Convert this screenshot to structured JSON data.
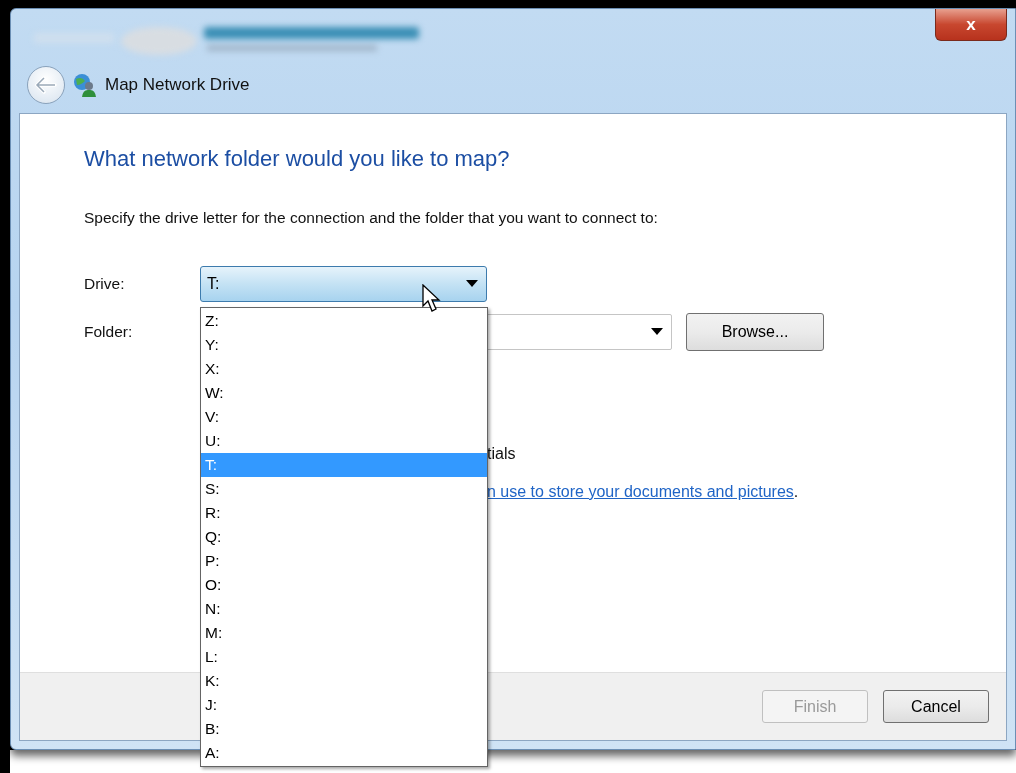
{
  "window": {
    "title": "Map Network Drive",
    "close_glyph": "x"
  },
  "heading": "What network folder would you like to map?",
  "instruction": "Specify the drive letter for the connection and the folder that you want to connect to:",
  "drive": {
    "label": "Drive:",
    "value": "T:",
    "expanded": true,
    "options": [
      {
        "label": "Z:",
        "selected": false
      },
      {
        "label": "Y:",
        "selected": false
      },
      {
        "label": "X:",
        "selected": false
      },
      {
        "label": "W:",
        "selected": false
      },
      {
        "label": "V:",
        "selected": false
      },
      {
        "label": "U:",
        "selected": false
      },
      {
        "label": "T:",
        "selected": true
      },
      {
        "label": "S:",
        "selected": false
      },
      {
        "label": "R:",
        "selected": false
      },
      {
        "label": "Q:",
        "selected": false
      },
      {
        "label": "P:",
        "selected": false
      },
      {
        "label": "O:",
        "selected": false
      },
      {
        "label": "N:",
        "selected": false
      },
      {
        "label": "M:",
        "selected": false
      },
      {
        "label": "L:",
        "selected": false
      },
      {
        "label": "K:",
        "selected": false
      },
      {
        "label": "J:",
        "selected": false
      },
      {
        "label": "B:",
        "selected": false
      },
      {
        "label": "A:",
        "selected": false
      }
    ]
  },
  "folder": {
    "label": "Folder:"
  },
  "browse_button": "Browse...",
  "credentials_fragment": "tials",
  "link_fragment": {
    "link": "n use to store your documents and pictures",
    "suffix": "."
  },
  "buttons": [
    {
      "label": "Finish",
      "disabled": true
    },
    {
      "label": "Cancel",
      "disabled": false
    }
  ]
}
